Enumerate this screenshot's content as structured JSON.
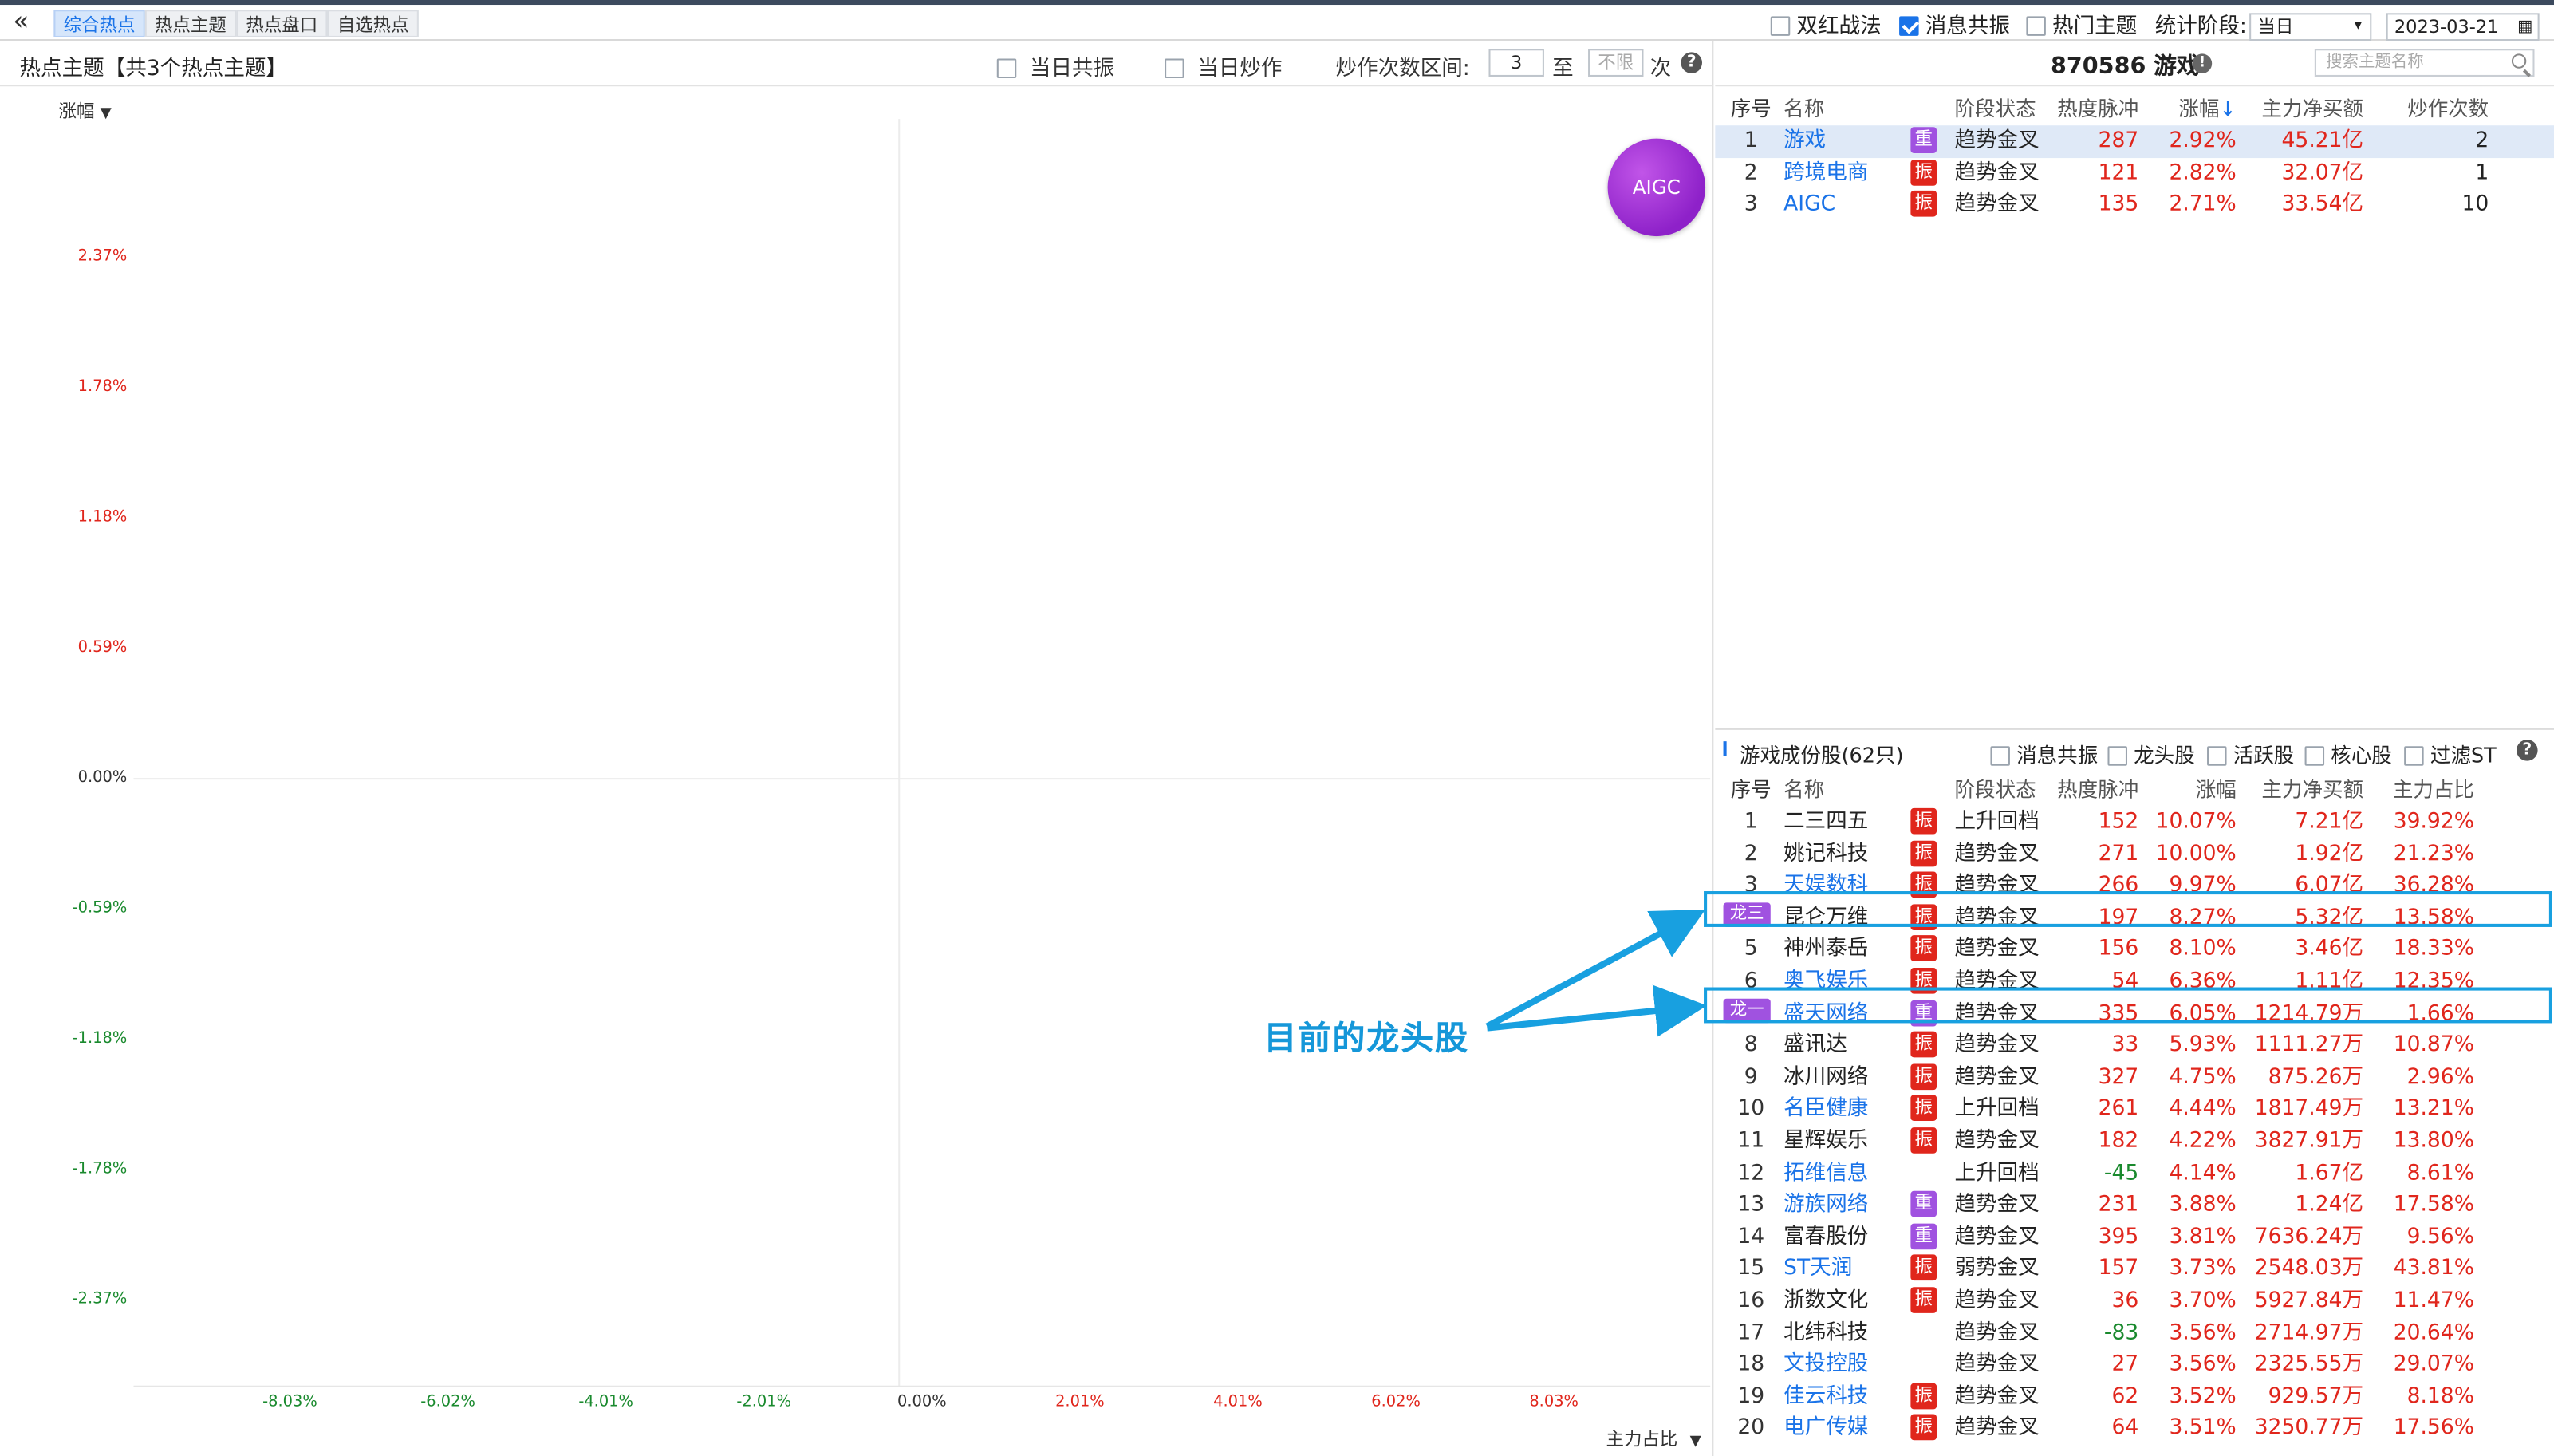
{
  "tabs": {
    "back": "«",
    "items": [
      {
        "label": "综合热点",
        "active": true
      },
      {
        "label": "热点主题",
        "active": false
      },
      {
        "label": "热点盘口",
        "active": false
      },
      {
        "label": "自选热点",
        "active": false
      }
    ]
  },
  "top_right": {
    "opt_double_red": "双红战法",
    "opt_news": "消息共振",
    "opt_hot_theme": "热门主题",
    "stat_label": "统计阶段:",
    "stat_value": "当日",
    "date_value": "2023-03-21"
  },
  "left": {
    "title": "热点主题【共3个热点主题】",
    "opt_same_day_resonance": "当日共振",
    "opt_same_day_hype": "当日炒作",
    "hype_range_label": "炒作次数区间:",
    "range_from": "3",
    "range_to_label": "至",
    "range_to_placeholder": "不限",
    "times_label": "次",
    "help": "?",
    "y_selector": "涨幅",
    "x_selector": "主力占比",
    "bubble_label": "AIGC"
  },
  "chart_data": {
    "type": "scatter",
    "xlabel": "主力占比",
    "ylabel": "涨幅",
    "y_ticks": [
      "2.37%",
      "1.78%",
      "1.18%",
      "0.59%",
      "0.00%",
      "-0.59%",
      "-1.18%",
      "-1.78%",
      "-2.37%"
    ],
    "x_ticks": [
      "-8.03%",
      "-6.02%",
      "-4.01%",
      "-2.01%",
      "0.00%",
      "2.01%",
      "4.01%",
      "6.02%",
      "8.03%"
    ],
    "points": [
      {
        "label": "AIGC"
      }
    ]
  },
  "theme_panel": {
    "title": "870586 游戏",
    "search_placeholder": "搜索主题名称",
    "headers": {
      "idx": "序号",
      "name": "名称",
      "stage": "阶段状态",
      "heat": "热度脉冲",
      "pct": "涨幅",
      "amt": "主力净买额",
      "cnt": "炒作次数"
    },
    "rows": [
      {
        "idx": "1",
        "name": "游戏",
        "badge": "重",
        "stage": "趋势金叉",
        "heat": "287",
        "pct": "2.92%",
        "amt": "45.21亿",
        "cnt": "2"
      },
      {
        "idx": "2",
        "name": "跨境电商",
        "badge": "振",
        "stage": "趋势金叉",
        "heat": "121",
        "pct": "2.82%",
        "amt": "32.07亿",
        "cnt": "1"
      },
      {
        "idx": "3",
        "name": "AIGC",
        "badge": "振",
        "stage": "趋势金叉",
        "heat": "135",
        "pct": "2.71%",
        "amt": "33.54亿",
        "cnt": "10"
      }
    ]
  },
  "component_panel": {
    "title": "游戏成份股(62只)",
    "opt_news": "消息共振",
    "opt_dragon": "龙头股",
    "opt_active": "活跃股",
    "opt_core": "核心股",
    "opt_filter_st": "过滤ST",
    "help": "?",
    "headers": {
      "idx": "序号",
      "name": "名称",
      "stage": "阶段状态",
      "heat": "热度脉冲",
      "pct": "涨幅",
      "amt": "主力净买额",
      "ratio": "主力占比"
    },
    "rows": [
      {
        "idx": "1",
        "name": "二三四五",
        "link": false,
        "badge": "振",
        "stage": "上升回档",
        "heat": "152",
        "heat_neg": false,
        "pct": "10.07%",
        "amt": "7.21亿",
        "ratio": "39.92%"
      },
      {
        "idx": "2",
        "name": "姚记科技",
        "link": false,
        "badge": "振",
        "stage": "趋势金叉",
        "heat": "271",
        "heat_neg": false,
        "pct": "10.00%",
        "amt": "1.92亿",
        "ratio": "21.23%"
      },
      {
        "idx": "3",
        "name": "天娱数科",
        "link": true,
        "badge": "振",
        "stage": "趋势金叉",
        "heat": "266",
        "heat_neg": false,
        "pct": "9.97%",
        "amt": "6.07亿",
        "ratio": "36.28%"
      },
      {
        "idx": "龙三",
        "dragon": true,
        "name": "昆仑万维",
        "link": false,
        "badge": "振",
        "stage": "趋势金叉",
        "heat": "197",
        "heat_neg": false,
        "pct": "8.27%",
        "amt": "5.32亿",
        "ratio": "13.58%"
      },
      {
        "idx": "5",
        "name": "神州泰岳",
        "link": false,
        "badge": "振",
        "stage": "趋势金叉",
        "heat": "156",
        "heat_neg": false,
        "pct": "8.10%",
        "amt": "3.46亿",
        "ratio": "18.33%"
      },
      {
        "idx": "6",
        "name": "奥飞娱乐",
        "link": true,
        "badge": "振",
        "stage": "趋势金叉",
        "heat": "54",
        "heat_neg": false,
        "pct": "6.36%",
        "amt": "1.11亿",
        "ratio": "12.35%"
      },
      {
        "idx": "龙一",
        "dragon": true,
        "name": "盛天网络",
        "link": true,
        "badge": "重",
        "stage": "趋势金叉",
        "heat": "335",
        "heat_neg": false,
        "pct": "6.05%",
        "amt": "1214.79万",
        "ratio": "1.66%"
      },
      {
        "idx": "8",
        "name": "盛讯达",
        "link": false,
        "badge": "振",
        "stage": "趋势金叉",
        "heat": "33",
        "heat_neg": false,
        "pct": "5.93%",
        "amt": "1111.27万",
        "ratio": "10.87%"
      },
      {
        "idx": "9",
        "name": "冰川网络",
        "link": false,
        "badge": "振",
        "stage": "趋势金叉",
        "heat": "327",
        "heat_neg": false,
        "pct": "4.75%",
        "amt": "875.26万",
        "ratio": "2.96%"
      },
      {
        "idx": "10",
        "name": "名臣健康",
        "link": true,
        "badge": "振",
        "stage": "上升回档",
        "heat": "261",
        "heat_neg": false,
        "pct": "4.44%",
        "amt": "1817.49万",
        "ratio": "13.21%"
      },
      {
        "idx": "11",
        "name": "星辉娱乐",
        "link": false,
        "badge": "振",
        "stage": "趋势金叉",
        "heat": "182",
        "heat_neg": false,
        "pct": "4.22%",
        "amt": "3827.91万",
        "ratio": "13.80%"
      },
      {
        "idx": "12",
        "name": "拓维信息",
        "link": true,
        "badge": "",
        "stage": "上升回档",
        "heat": "-45",
        "heat_neg": true,
        "pct": "4.14%",
        "amt": "1.67亿",
        "ratio": "8.61%"
      },
      {
        "idx": "13",
        "name": "游族网络",
        "link": true,
        "badge": "重",
        "stage": "趋势金叉",
        "heat": "231",
        "heat_neg": false,
        "pct": "3.88%",
        "amt": "1.24亿",
        "ratio": "17.58%"
      },
      {
        "idx": "14",
        "name": "富春股份",
        "link": false,
        "badge": "重",
        "stage": "趋势金叉",
        "heat": "395",
        "heat_neg": false,
        "pct": "3.81%",
        "amt": "7636.24万",
        "ratio": "9.56%"
      },
      {
        "idx": "15",
        "name": "ST天润",
        "link": true,
        "badge": "振",
        "stage": "弱势金叉",
        "heat": "157",
        "heat_neg": false,
        "pct": "3.73%",
        "amt": "2548.03万",
        "ratio": "43.81%"
      },
      {
        "idx": "16",
        "name": "浙数文化",
        "link": false,
        "badge": "振",
        "stage": "趋势金叉",
        "heat": "36",
        "heat_neg": false,
        "pct": "3.70%",
        "amt": "5927.84万",
        "ratio": "11.47%"
      },
      {
        "idx": "17",
        "name": "北纬科技",
        "link": false,
        "badge": "",
        "stage": "趋势金叉",
        "heat": "-83",
        "heat_neg": true,
        "pct": "3.56%",
        "amt": "2714.97万",
        "ratio": "20.64%"
      },
      {
        "idx": "18",
        "name": "文投控股",
        "link": true,
        "badge": "",
        "stage": "趋势金叉",
        "heat": "27",
        "heat_neg": false,
        "pct": "3.56%",
        "amt": "2325.55万",
        "ratio": "29.07%"
      },
      {
        "idx": "19",
        "name": "佳云科技",
        "link": true,
        "badge": "振",
        "stage": "趋势金叉",
        "heat": "62",
        "heat_neg": false,
        "pct": "3.52%",
        "amt": "929.57万",
        "ratio": "8.18%"
      },
      {
        "idx": "20",
        "name": "电广传媒",
        "link": true,
        "badge": "振",
        "stage": "趋势金叉",
        "heat": "64",
        "heat_neg": false,
        "pct": "3.51%",
        "amt": "3250.77万",
        "ratio": "17.56%"
      }
    ]
  },
  "annotation": {
    "text": "目前的龙头股",
    "color": "#1597d9"
  },
  "colors": {
    "up": "#e0261c",
    "down": "#1a8a2e",
    "link": "#1a73e8",
    "badge_zhen": "#e0261c",
    "badge_zhong": "#a052e0",
    "selected_row": "#dfe9f7"
  }
}
